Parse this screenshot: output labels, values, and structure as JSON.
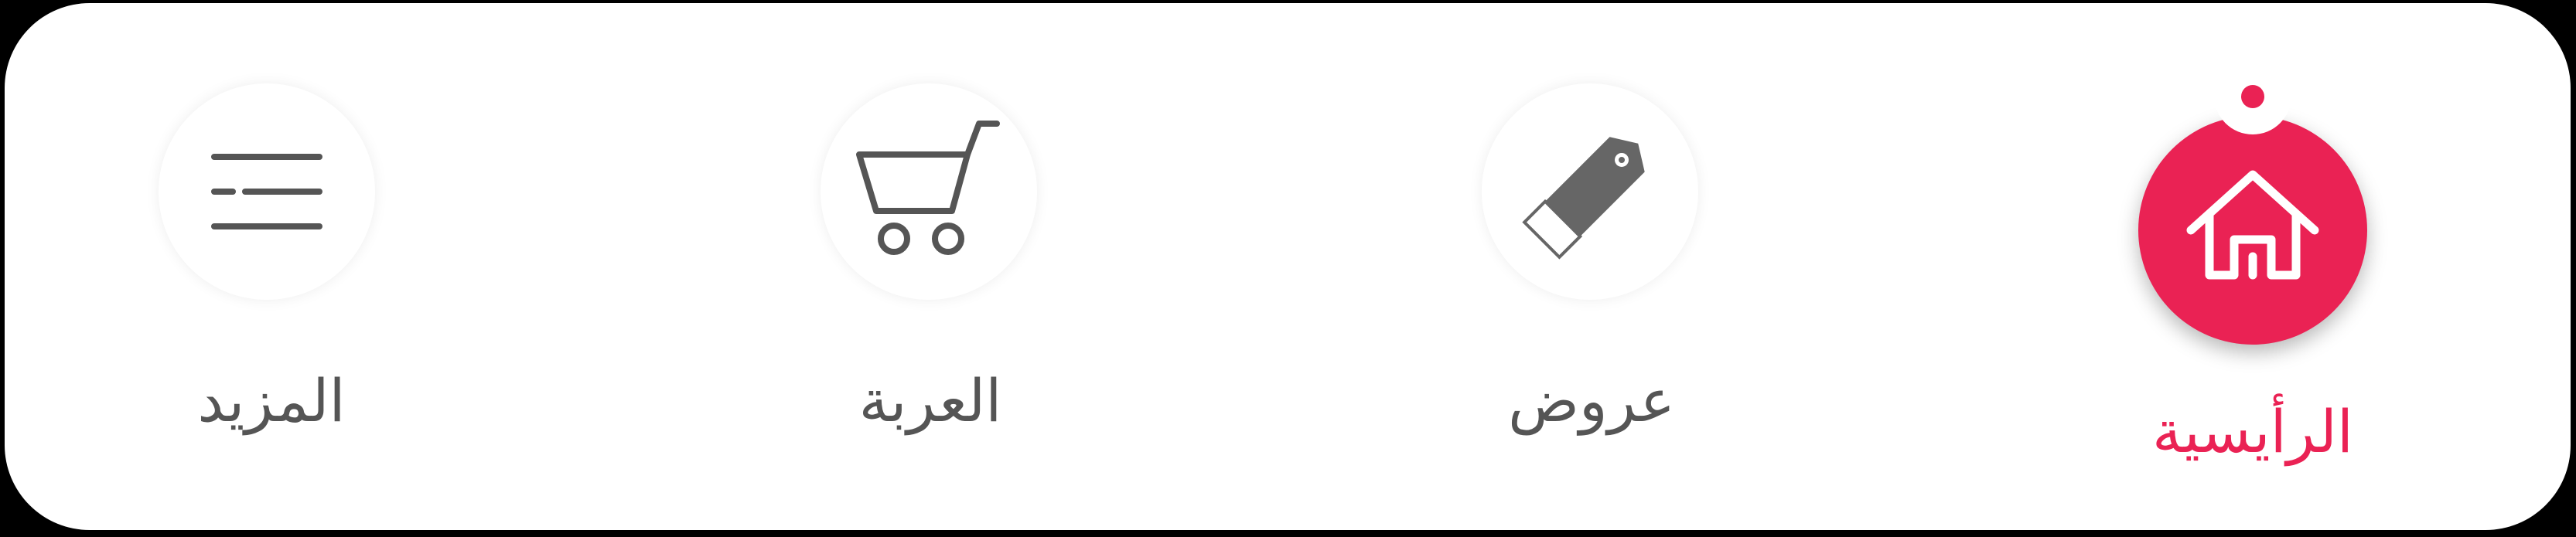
{
  "colors": {
    "accent": "#ea2254",
    "inactive_text": "#555555",
    "icon": "#555555",
    "background": "#ffffff"
  },
  "nav": {
    "items": [
      {
        "id": "more",
        "label": "المزيد",
        "icon": "menu-icon",
        "active": false
      },
      {
        "id": "cart",
        "label": "العربة",
        "icon": "cart-icon",
        "active": false
      },
      {
        "id": "offers",
        "label": "عروض",
        "icon": "price-tag-icon",
        "active": false
      },
      {
        "id": "home",
        "label": "الرأيسية",
        "icon": "home-icon",
        "active": true
      }
    ]
  }
}
